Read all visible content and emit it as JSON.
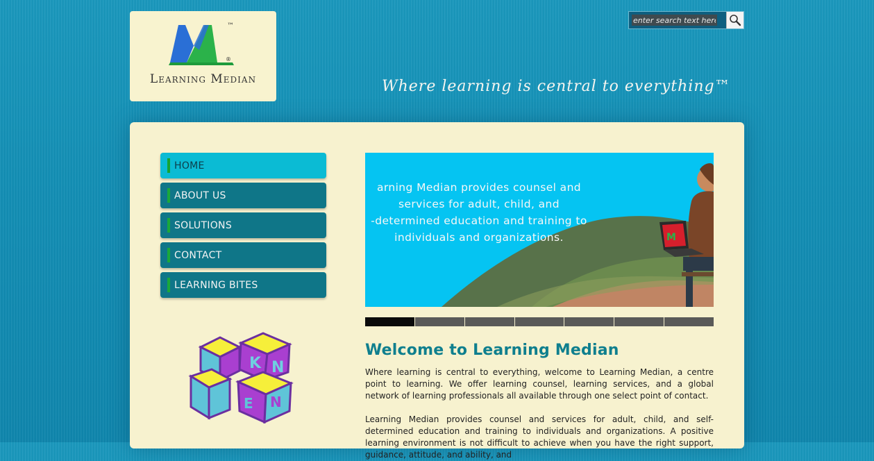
{
  "logo": {
    "name": "Learning Median",
    "trademark": "™",
    "registered": "®"
  },
  "search": {
    "placeholder": "enter search text here",
    "button_icon": "magnifier-icon"
  },
  "tagline": "Where learning is central to everything™",
  "nav": {
    "items": [
      {
        "label": "HOME",
        "active": true
      },
      {
        "label": "ABOUT US",
        "active": false
      },
      {
        "label": "SOLUTIONS",
        "active": false
      },
      {
        "label": "CONTACT",
        "active": false
      },
      {
        "label": "LEARNING BITES",
        "active": false
      }
    ]
  },
  "banner": {
    "text": "arning Median provides counsel and services for adult, child, and -determined education and training to individuals and organizations.",
    "lines": [
      "arning Median provides counsel and",
      "services for adult, child, and",
      "-determined education and training to",
      "individuals and organizations."
    ]
  },
  "slider": {
    "count": 7,
    "active_index": 0
  },
  "content": {
    "heading": "Welcome to Learning Median",
    "paragraph1": "Where learning is central to everything, welcome to Learning Median, a centre point to learning. We offer learning counsel, learning services, and a global network of learning professionals all available through one select point of contact.",
    "paragraph2": "Learning Median provides counsel and services for adult, child, and self-determined education and training to individuals and organizations. A positive learning environment is not difficult to achieve when you have the right support, guidance, attitude, and ability, and"
  },
  "cubes": {
    "letters": [
      "K",
      "N",
      "E",
      "N"
    ]
  },
  "colors": {
    "background": "#138fb5",
    "panel": "#f7f2cf",
    "nav": "#0f7688",
    "nav_active": "#0bbbd4",
    "accent_green": "#1aa83a",
    "heading": "#0f7f8e",
    "banner": "#05c4f2"
  }
}
